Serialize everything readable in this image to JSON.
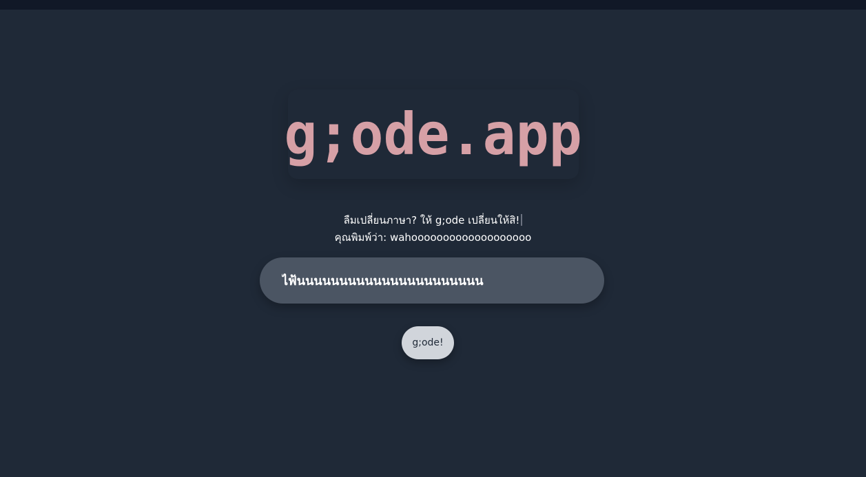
{
  "header": {},
  "logo": {
    "text": "g;ode.app",
    "color": "#d6a0a6"
  },
  "tagline": {
    "text": "ลืมเปลี่ยนภาษา? ให้ g;ode เปลี่ยนให้สิ!"
  },
  "typed": {
    "label": "คุณพิมพ์ว่า:",
    "value": "wahooooooooooooooooooo"
  },
  "input": {
    "value": "ไฟ้นนนนนนนนนนนนนนนนนนนนนน"
  },
  "button": {
    "label": "g;ode!"
  },
  "colors": {
    "background": "#1f2937",
    "topbar": "#111827",
    "input_bg": "#4b5563",
    "button_bg": "#d1d5db"
  }
}
